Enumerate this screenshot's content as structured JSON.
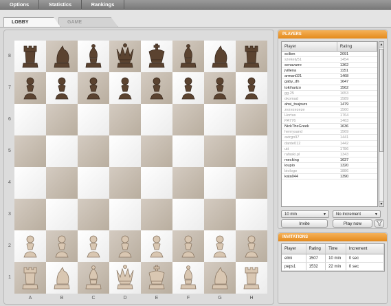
{
  "menu": [
    "Options",
    "Statistics",
    "Rankings"
  ],
  "tabs": {
    "lobby": "LOBBY",
    "game": "GAME"
  },
  "board": {
    "ranks": [
      "8",
      "7",
      "6",
      "5",
      "4",
      "3",
      "2",
      "1"
    ],
    "files": [
      "A",
      "B",
      "C",
      "D",
      "E",
      "F",
      "G",
      "H"
    ],
    "position": [
      [
        "bR",
        "bN",
        "bB",
        "bQ",
        "bK",
        "bB",
        "bN",
        "bR"
      ],
      [
        "bP",
        "bP",
        "bP",
        "bP",
        "bP",
        "bP",
        "bP",
        "bP"
      ],
      [
        "",
        "",
        "",
        "",
        "",
        "",
        "",
        ""
      ],
      [
        "",
        "",
        "",
        "",
        "",
        "",
        "",
        ""
      ],
      [
        "",
        "",
        "",
        "",
        "",
        "",
        "",
        ""
      ],
      [
        "",
        "",
        "",
        "",
        "",
        "",
        "",
        ""
      ],
      [
        "wP",
        "wP",
        "wP",
        "wP",
        "wP",
        "wP",
        "wP",
        "wP"
      ],
      [
        "wR",
        "wN",
        "wB",
        "wQ",
        "wK",
        "wB",
        "wN",
        "wR"
      ]
    ],
    "colors": {
      "light": "#f4f4f4",
      "dark": "#c4b9ad",
      "black_piece": "#5b4330",
      "white_piece": "#d9c7b2"
    }
  },
  "players": {
    "title": "PLAYERS",
    "col_player": "Player",
    "col_rating": "Rating",
    "rows": [
      {
        "name": "scilien",
        "rating": "2091",
        "style": ""
      },
      {
        "name": "szekely51",
        "rating": "1454",
        "style": "grey"
      },
      {
        "name": "senavarre",
        "rating": "1362",
        "style": ""
      },
      {
        "name": "jvillena",
        "rating": "1151",
        "style": ""
      },
      {
        "name": "arman021",
        "rating": "1468",
        "style": ""
      },
      {
        "name": "gaby_dh",
        "rating": "1647",
        "style": ""
      },
      {
        "name": "tokiharizo",
        "rating": "1562",
        "style": ""
      },
      {
        "name": "gg.25",
        "rating": "1653",
        "style": "grey"
      },
      {
        "name": "okomad",
        "rating": "1589",
        "style": "grey"
      },
      {
        "name": "ahsi_toujours",
        "rating": "1479",
        "style": ""
      },
      {
        "name": "zezezezeze",
        "rating": "1560",
        "style": "grey"
      },
      {
        "name": "Hortus",
        "rating": "1764",
        "style": "grey"
      },
      {
        "name": "PA776",
        "rating": "1463",
        "style": "grey"
      },
      {
        "name": "NickTheGreek",
        "rating": "1636",
        "style": ""
      },
      {
        "name": "henrysand",
        "rating": "1569",
        "style": "grey"
      },
      {
        "name": "axirgo97",
        "rating": "1441",
        "style": "grey"
      },
      {
        "name": "dante012",
        "rating": "1442",
        "style": "grey"
      },
      {
        "name": "utt",
        "rating": "1786",
        "style": "grey"
      },
      {
        "name": "rafaski.pl",
        "rating": "1343",
        "style": "grey"
      },
      {
        "name": "mecking",
        "rating": "1637",
        "style": ""
      },
      {
        "name": "loupio",
        "rating": "1320",
        "style": ""
      },
      {
        "name": "biologo",
        "rating": "1886",
        "style": "grey"
      },
      {
        "name": "kata044",
        "rating": "1390",
        "style": ""
      }
    ],
    "time_select": "10 min",
    "increment_select": "No Increment",
    "invite_label": "Invite",
    "play_label": "Play now",
    "filter_icon": "filter-icon"
  },
  "invitations": {
    "title": "INVITATIONS",
    "cols": [
      "Player",
      "Rating",
      "Time",
      "Increment"
    ],
    "rows": [
      {
        "player": "elmi",
        "rating": "1507",
        "time": "10 min",
        "increment": "0 sec"
      },
      {
        "player": "peps1",
        "rating": "1532",
        "time": "22 min",
        "increment": "0 sec"
      }
    ]
  }
}
